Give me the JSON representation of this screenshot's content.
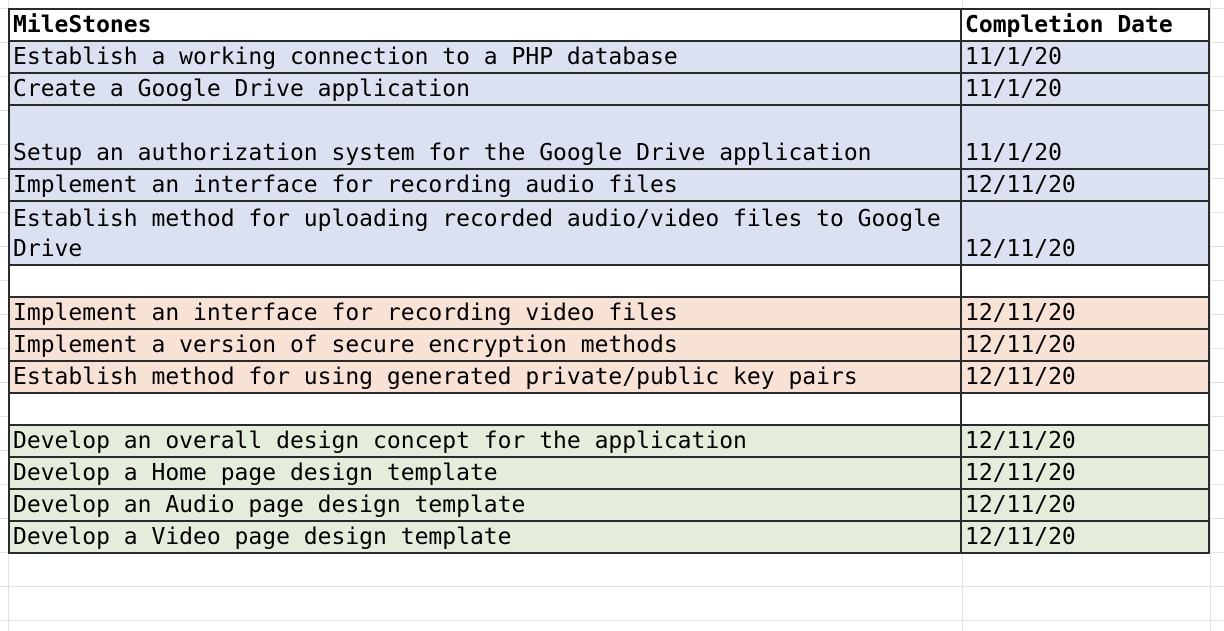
{
  "header": {
    "milestones": "MileStones",
    "completion_date": "Completion Date"
  },
  "colors": {
    "blue": "#dce1f1",
    "orange": "#f8e1d5",
    "green": "#e4ecdb"
  },
  "rows": [
    {
      "milestone": "Establish a working connection to a PHP database",
      "date": "11/1/20",
      "group": "blue"
    },
    {
      "milestone": "Create a Google Drive application",
      "date": "11/1/20",
      "group": "blue"
    },
    {
      "milestone": "Setup an authorization system for the Google Drive application",
      "date": "11/1/20",
      "group": "blue"
    },
    {
      "milestone": "Implement an interface for recording audio files",
      "date": "12/11/20",
      "group": "blue"
    },
    {
      "milestone": "Establish method for uploading recorded audio/video files to Google Drive",
      "date": "12/11/20",
      "group": "blue"
    },
    {
      "milestone": "",
      "date": "",
      "group": "none"
    },
    {
      "milestone": "Implement an interface for recording video files",
      "date": "12/11/20",
      "group": "orange"
    },
    {
      "milestone": "Implement a version of secure encryption methods",
      "date": "12/11/20",
      "group": "orange"
    },
    {
      "milestone": "Establish method for using generated private/public key pairs",
      "date": "12/11/20",
      "group": "orange"
    },
    {
      "milestone": "",
      "date": "",
      "group": "none"
    },
    {
      "milestone": "Develop an overall design concept for the application",
      "date": "12/11/20",
      "group": "green"
    },
    {
      "milestone": "Develop a Home page design template",
      "date": "12/11/20",
      "group": "green"
    },
    {
      "milestone": "Develop an Audio page design template",
      "date": "12/11/20",
      "group": "green"
    },
    {
      "milestone": "Develop a Video page design template",
      "date": "12/11/20",
      "group": "green"
    }
  ]
}
